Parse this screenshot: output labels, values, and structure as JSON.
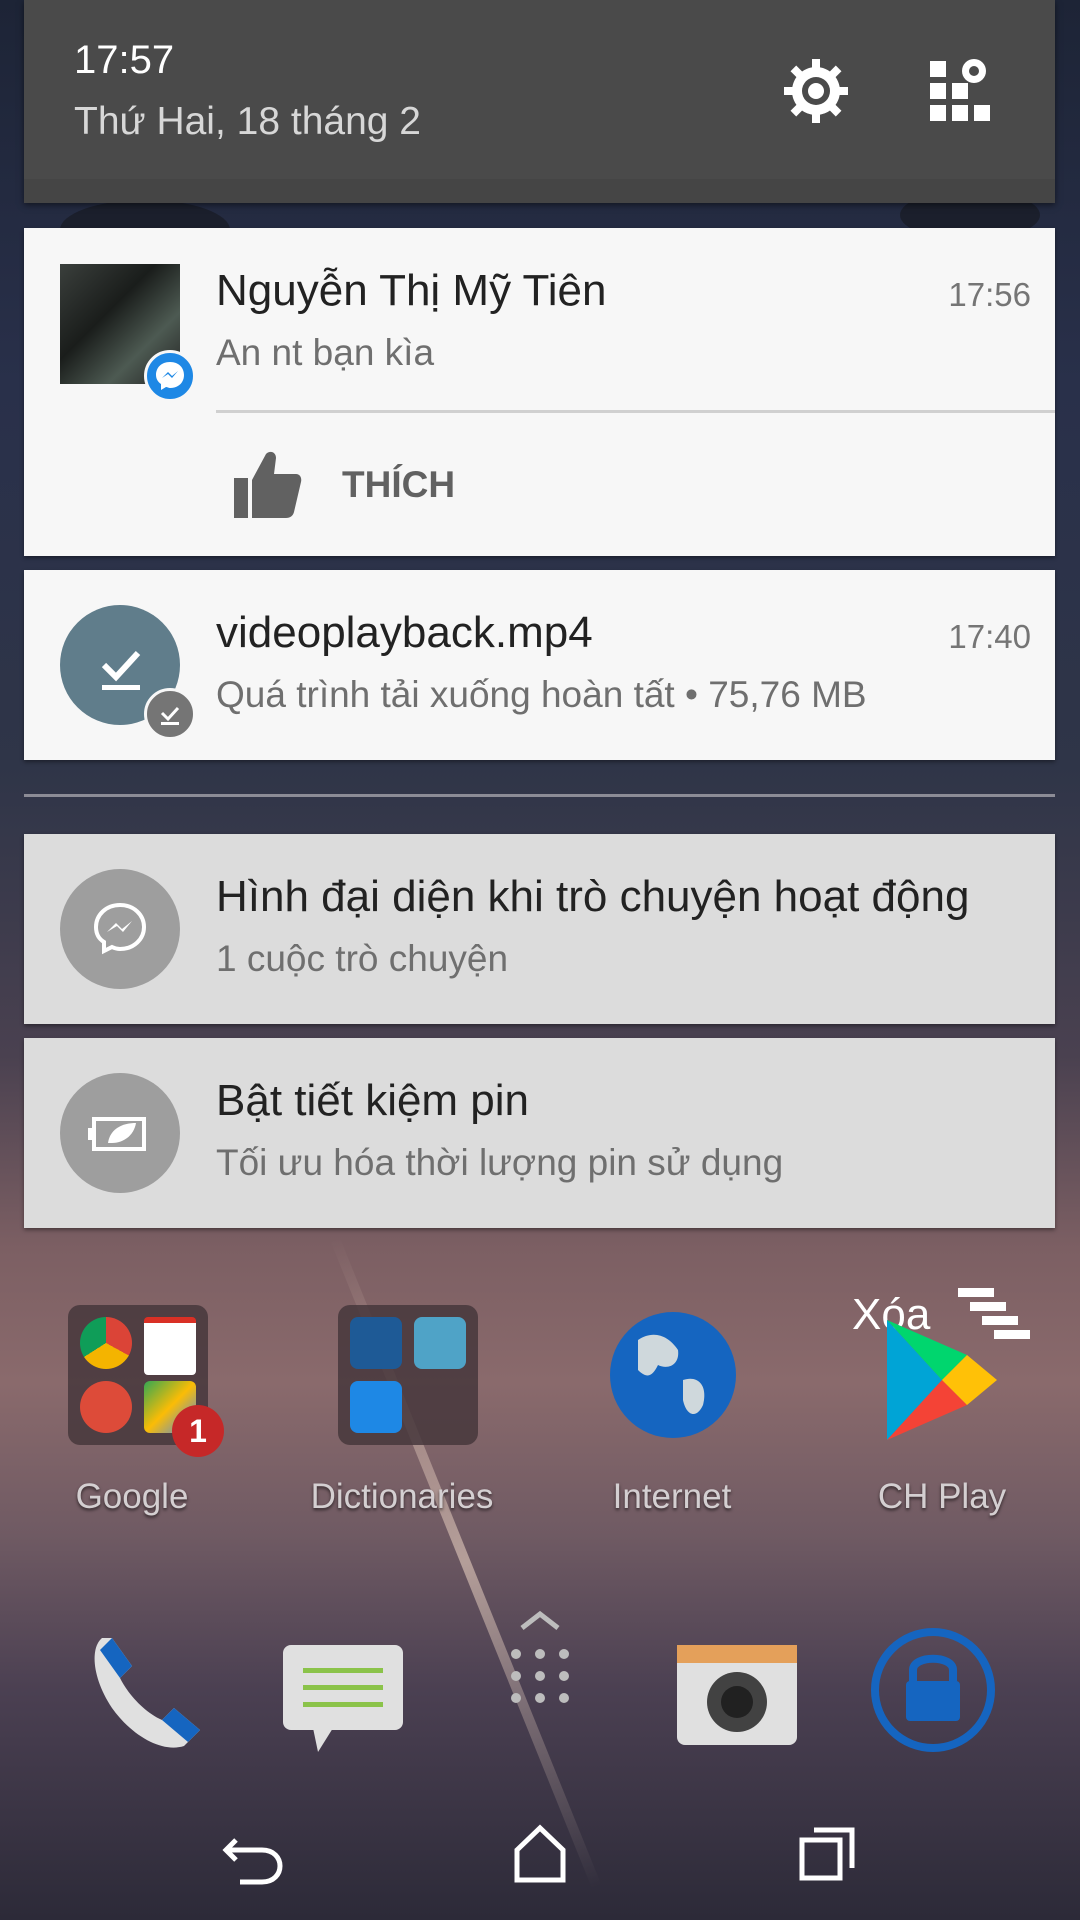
{
  "status_header": {
    "time": "17:57",
    "date": "Thứ Hai, 18 tháng 2"
  },
  "notifications": [
    {
      "app": "messenger",
      "sender": "Nguyễn Thị Mỹ Tiên",
      "message": "An nt bạn kìa",
      "time": "17:56",
      "action_label": "THÍCH"
    },
    {
      "app": "download",
      "title": "videoplayback.mp4",
      "message": "Quá trình tải xuống hoàn tất • 75,76 MB",
      "time": "17:40"
    }
  ],
  "low_priority": [
    {
      "title": "Hình đại diện khi trò chuyện hoạt động",
      "message": "1 cuộc trò chuyện"
    },
    {
      "title": "Bật tiết kiệm pin",
      "message": "Tối ưu hóa thời lượng pin sử dụng"
    }
  ],
  "clear_all_label": "Xóa",
  "home_apps": [
    {
      "label": "Google",
      "badge": "1"
    },
    {
      "label": "Dictionaries"
    },
    {
      "label": "Internet"
    },
    {
      "label": "CH Play"
    }
  ],
  "colors": {
    "messenger_blue": "#1e88e5",
    "download_circle": "#607d8b",
    "notif_grey_circle": "#9e9e9e",
    "lock_blue": "#1565c0"
  },
  "icons": {
    "settings": "gear-icon",
    "edit_tiles": "tiles-edit-icon",
    "like": "thumbs-up-icon",
    "dock": [
      "phone-icon",
      "messages-icon",
      "app-drawer-icon",
      "camera-icon",
      "lock-icon"
    ],
    "nav": [
      "back-icon",
      "home-icon",
      "recents-icon"
    ]
  }
}
